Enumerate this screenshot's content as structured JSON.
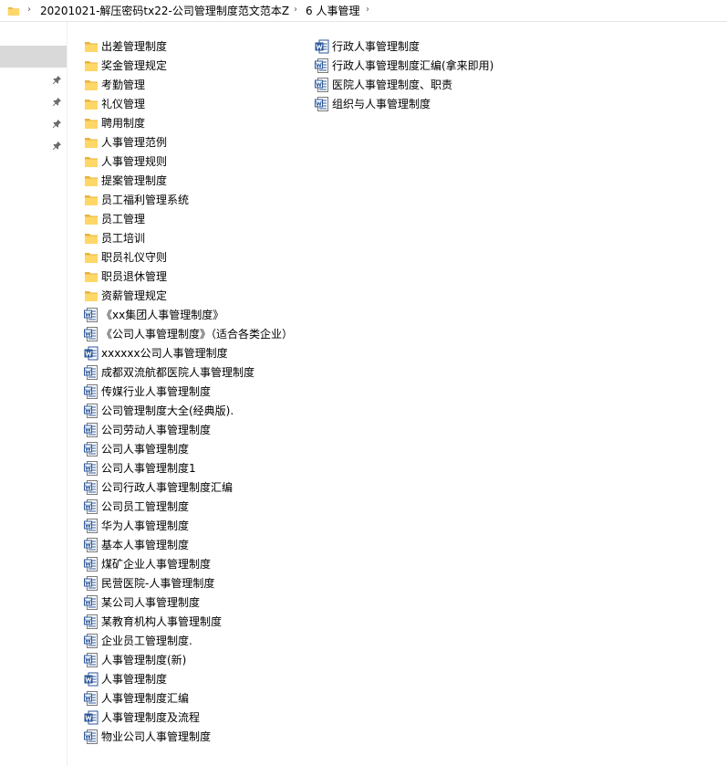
{
  "breadcrumb": {
    "folder_icon": "folder-icon",
    "separator": "›",
    "items": [
      {
        "label": "20201021-解压密码tx22-公司管理制度范文范本Z"
      },
      {
        "label": "6 人事管理"
      }
    ]
  },
  "navigation": {
    "pin_icon": "pin-icon",
    "selected_color": "#d9d9d9"
  },
  "colors": {
    "folder_yellow": "#ffd766",
    "folder_dark": "#e8b33c",
    "word_blue": "#2b579a"
  },
  "files": {
    "column1": [
      {
        "name": "出差管理制度",
        "type": "folder"
      },
      {
        "name": "奖金管理规定",
        "type": "folder"
      },
      {
        "name": "考勤管理",
        "type": "folder"
      },
      {
        "name": "礼仪管理",
        "type": "folder"
      },
      {
        "name": "聘用制度",
        "type": "folder"
      },
      {
        "name": "人事管理范例",
        "type": "folder"
      },
      {
        "name": "人事管理规则",
        "type": "folder"
      },
      {
        "name": "提案管理制度",
        "type": "folder"
      },
      {
        "name": "员工福利管理系统",
        "type": "folder"
      },
      {
        "name": "员工管理",
        "type": "folder"
      },
      {
        "name": "员工培训",
        "type": "folder"
      },
      {
        "name": "职员礼仪守则",
        "type": "folder"
      },
      {
        "name": "职员退休管理",
        "type": "folder"
      },
      {
        "name": "资薪管理规定",
        "type": "folder"
      },
      {
        "name": "《xx集团人事管理制度》",
        "type": "word-doc"
      },
      {
        "name": "《公司人事管理制度》（适合各类企业）",
        "type": "word-doc"
      },
      {
        "name": "xxxxxx公司人事管理制度",
        "type": "word-docx"
      },
      {
        "name": "成都双流航都医院人事管理制度",
        "type": "word-doc"
      },
      {
        "name": "传媒行业人事管理制度",
        "type": "word-doc"
      },
      {
        "name": "公司管理制度大全(经典版).",
        "type": "word-doc"
      },
      {
        "name": "公司劳动人事管理制度",
        "type": "word-doc"
      },
      {
        "name": "公司人事管理制度",
        "type": "word-doc"
      },
      {
        "name": "公司人事管理制度1",
        "type": "word-doc"
      },
      {
        "name": "公司行政人事管理制度汇编",
        "type": "word-doc"
      },
      {
        "name": "公司员工管理制度",
        "type": "word-doc"
      },
      {
        "name": "华为人事管理制度",
        "type": "word-doc"
      },
      {
        "name": "基本人事管理制度",
        "type": "word-doc"
      },
      {
        "name": "煤矿企业人事管理制度",
        "type": "word-doc"
      },
      {
        "name": "民营医院-人事管理制度",
        "type": "word-doc"
      },
      {
        "name": "某公司人事管理制度",
        "type": "word-doc"
      },
      {
        "name": "某教育机构人事管理制度",
        "type": "word-doc"
      },
      {
        "name": "企业员工管理制度.",
        "type": "word-doc"
      },
      {
        "name": "人事管理制度(新)",
        "type": "word-doc"
      },
      {
        "name": "人事管理制度",
        "type": "word-docx"
      },
      {
        "name": "人事管理制度汇编",
        "type": "word-doc"
      },
      {
        "name": "人事管理制度及流程",
        "type": "word-docx"
      },
      {
        "name": "物业公司人事管理制度",
        "type": "word-doc"
      }
    ],
    "column2": [
      {
        "name": "行政人事管理制度",
        "type": "word-docx"
      },
      {
        "name": "行政人事管理制度汇编(拿来即用)",
        "type": "word-doc"
      },
      {
        "name": "医院人事管理制度、职责",
        "type": "word-doc"
      },
      {
        "name": "组织与人事管理制度",
        "type": "word-doc"
      }
    ]
  }
}
